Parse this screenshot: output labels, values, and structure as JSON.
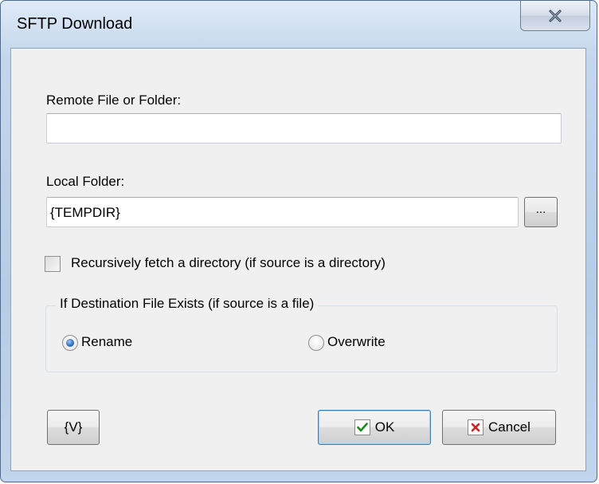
{
  "window": {
    "title": "SFTP Download"
  },
  "remote": {
    "label": "Remote File or Folder:",
    "value": ""
  },
  "local": {
    "label": "Local Folder:",
    "value": "{TEMPDIR}",
    "browse_label": "..."
  },
  "recursive": {
    "label": "Recursively fetch a directory (if source is a directory)",
    "checked": false
  },
  "destination": {
    "title": "If Destination File Exists (if source is a file)",
    "options": [
      {
        "label": "Rename",
        "selected": true
      },
      {
        "label": "Overwrite",
        "selected": false
      }
    ]
  },
  "buttons": {
    "variables": "{V}",
    "ok": "OK",
    "cancel": "Cancel"
  },
  "colors": {
    "ok_check": "#1e8a1e",
    "cancel_x": "#d22020"
  },
  "icons": [
    "close-icon",
    "check-icon",
    "x-icon"
  ]
}
